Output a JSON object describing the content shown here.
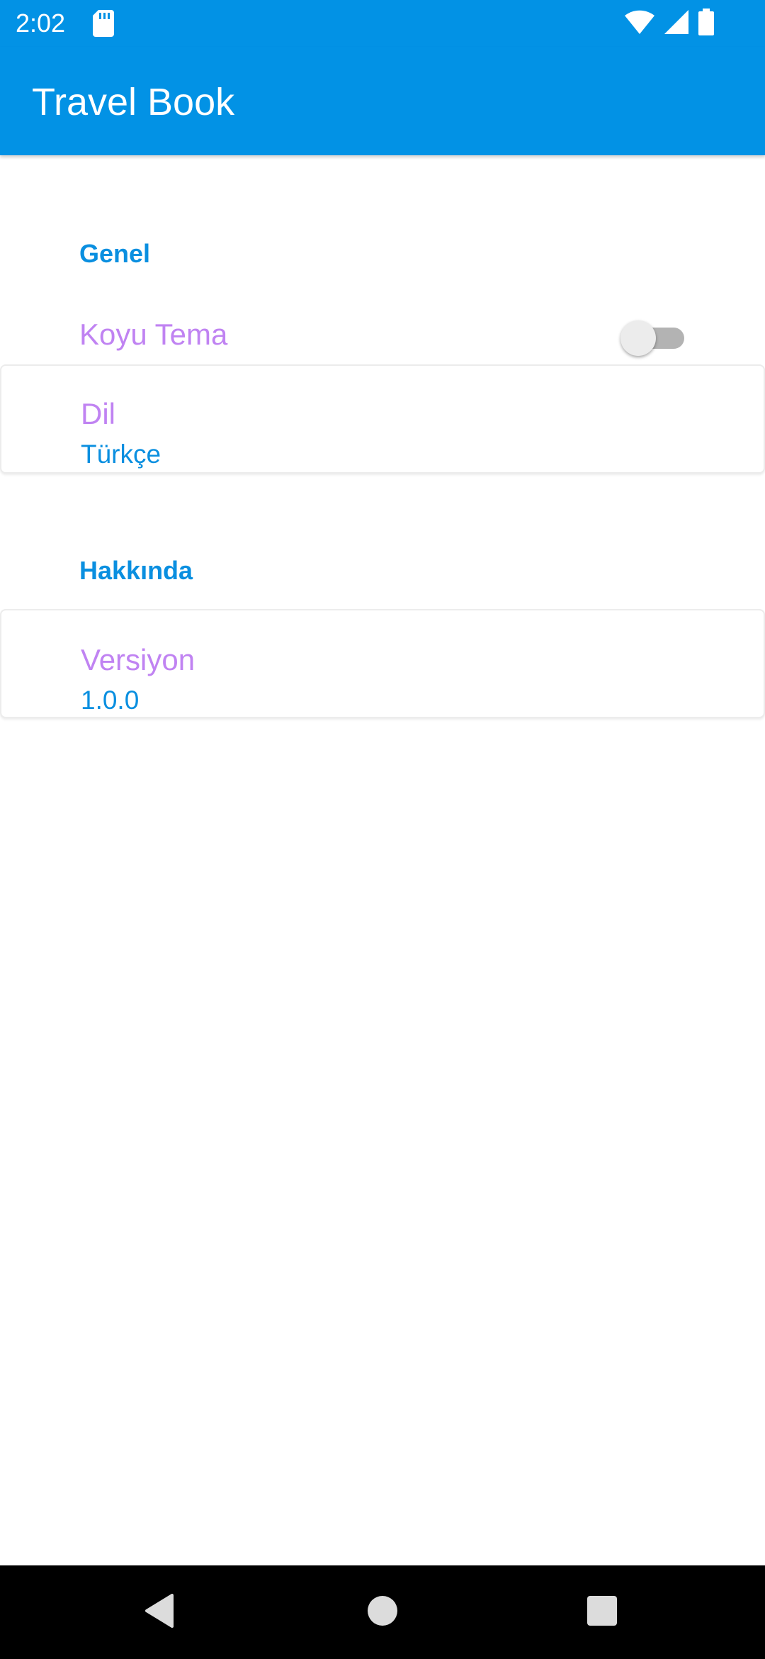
{
  "status_bar": {
    "time": "2:02",
    "icons": [
      "sd-card-icon",
      "wifi-icon",
      "cell-signal-icon",
      "battery-icon"
    ],
    "background": "#0292e5"
  },
  "app_bar": {
    "title": "Travel Book",
    "background": "#0292e5"
  },
  "sections": {
    "general": {
      "header": "Genel",
      "dark_theme": {
        "title": "Koyu Tema",
        "enabled": false
      },
      "language": {
        "title": "Dil",
        "summary": "Türkçe"
      }
    },
    "about": {
      "header": "Hakkında",
      "version": {
        "title": "Versiyon",
        "summary": "1.0.0"
      }
    }
  },
  "colors": {
    "accent": "#0a8fe0",
    "pref_title": "#c083f2",
    "switch_off_track": "#b3b3b3",
    "switch_off_thumb": "#ececec"
  },
  "nav_bar": {
    "icons": [
      "back-icon",
      "home-icon",
      "recents-icon"
    ]
  }
}
